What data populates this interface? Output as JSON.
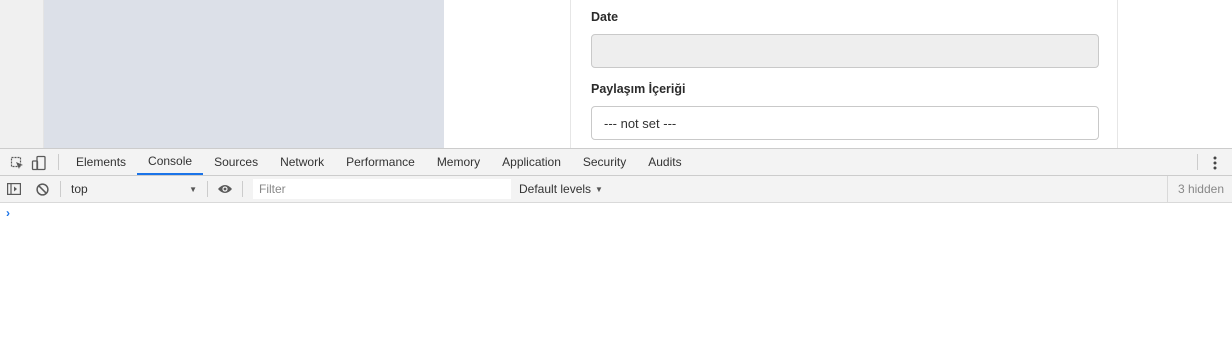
{
  "page": {
    "form": {
      "date_label": "Date",
      "date_value": "",
      "share_label": "Paylaşım İçeriği",
      "share_value": "--- not set ---"
    }
  },
  "devtools": {
    "tabs": [
      {
        "label": "Elements",
        "active": false
      },
      {
        "label": "Console",
        "active": true
      },
      {
        "label": "Sources",
        "active": false
      },
      {
        "label": "Network",
        "active": false
      },
      {
        "label": "Performance",
        "active": false
      },
      {
        "label": "Memory",
        "active": false
      },
      {
        "label": "Application",
        "active": false
      },
      {
        "label": "Security",
        "active": false
      },
      {
        "label": "Audits",
        "active": false
      }
    ],
    "console_toolbar": {
      "context": "top",
      "filter_placeholder": "Filter",
      "filter_value": "",
      "levels_label": "Default levels",
      "hidden_count": "3 hidden"
    },
    "prompt_symbol": "›",
    "accent_color": "#1a73e8",
    "icons": [
      "inspect-element-icon",
      "device-toolbar-icon",
      "more-options-icon",
      "show-sidebar-icon",
      "clear-console-icon",
      "live-expression-eye-icon"
    ]
  }
}
